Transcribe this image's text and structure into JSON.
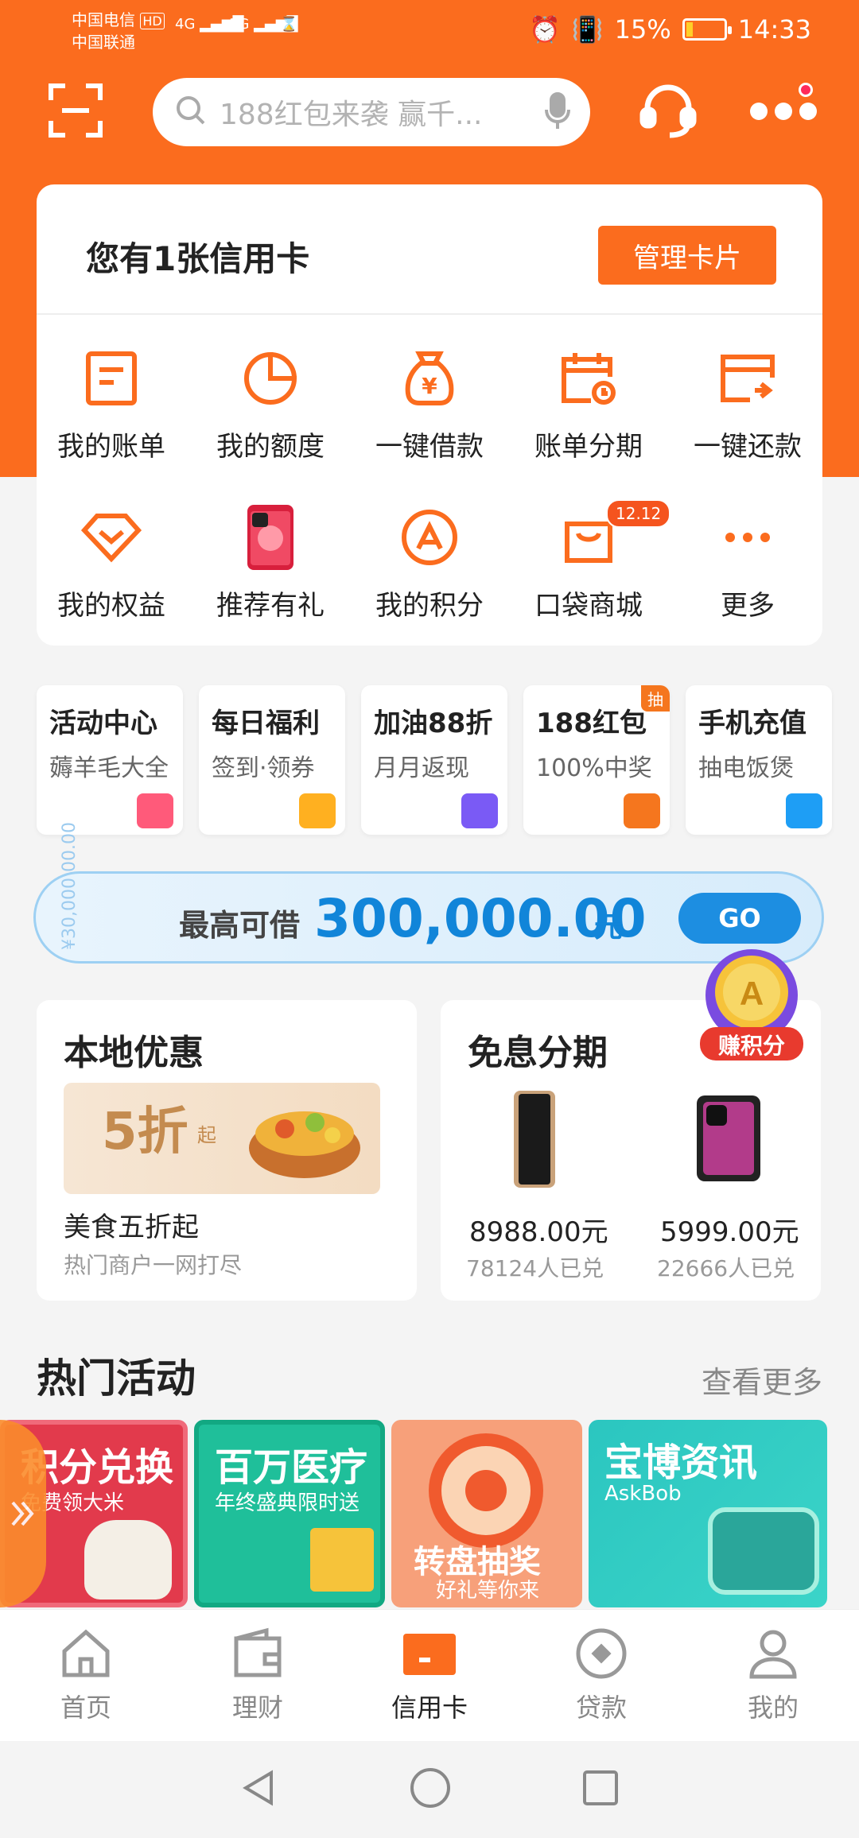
{
  "status": {
    "carrier1": "中国电信",
    "carrier2": "中国联通",
    "hd": "HD",
    "net1": "4G",
    "net2": "3G",
    "battery": "15%",
    "time": "14:33"
  },
  "search": {
    "placeholder": "188红包来袭 赢千..."
  },
  "card": {
    "title": "您有1张信用卡",
    "manage_label": "管理卡片"
  },
  "functions_row1": [
    {
      "label": "我的账单",
      "icon": "bill-icon"
    },
    {
      "label": "我的额度",
      "icon": "pie-chart-icon"
    },
    {
      "label": "一键借款",
      "icon": "money-bag-icon"
    },
    {
      "label": "账单分期",
      "icon": "calendar-clock-icon"
    },
    {
      "label": "一键还款",
      "icon": "card-repay-icon"
    }
  ],
  "functions_row2": [
    {
      "label": "我的权益",
      "icon": "diamond-icon"
    },
    {
      "label": "推荐有礼",
      "icon": "phone-icon"
    },
    {
      "label": "我的积分",
      "icon": "points-icon"
    },
    {
      "label": "口袋商城",
      "icon": "shopping-bag-icon",
      "badge": "12.12"
    },
    {
      "label": "更多",
      "icon": "more-dots-icon"
    }
  ],
  "tiles": [
    {
      "title": "活动中心",
      "sub": "薅羊毛大全",
      "color": "#ff5a7a"
    },
    {
      "title": "每日福利",
      "sub": "签到·领券",
      "color": "#ffb020"
    },
    {
      "title": "加油88折",
      "sub": "月月返现",
      "color": "#7a5af5"
    },
    {
      "title": "188红包",
      "sub": "100%中奖",
      "color": "#f5761e",
      "tag": "抽"
    },
    {
      "title": "手机充值",
      "sub": "抽电饭煲",
      "color": "#1e9ef5"
    }
  ],
  "loan": {
    "label": "最高可借",
    "amount": "300,000.00",
    "unit": "元",
    "go": "GO",
    "bg_text": "¥30,000 00.00"
  },
  "points_float": {
    "label": "赚积分"
  },
  "local": {
    "title": "本地优惠",
    "banner_big": "5折",
    "banner_small": "起",
    "desc": "美食五折起",
    "sub": "热门商户一网打尽"
  },
  "installment": {
    "title": "免息分期",
    "items": [
      {
        "price": "8988.00元",
        "count": "78124人已兑"
      },
      {
        "price": "5999.00元",
        "count": "22666人已兑"
      }
    ]
  },
  "hot": {
    "title": "热门活动",
    "more": "查看更多",
    "items": [
      {
        "title": "积分兑换",
        "sub": "免费领大米"
      },
      {
        "title": "百万医疗",
        "sub": "年终盛典限时送"
      },
      {
        "title": "转盘抽奖",
        "sub": "好礼等你来"
      },
      {
        "title": "宝博资讯",
        "sub": "AskBob"
      }
    ]
  },
  "nav": [
    {
      "label": "首页"
    },
    {
      "label": "理财"
    },
    {
      "label": "信用卡"
    },
    {
      "label": "贷款"
    },
    {
      "label": "我的"
    }
  ],
  "colors": {
    "brand": "#fb6c1e",
    "loan_blue": "#1185d9"
  }
}
